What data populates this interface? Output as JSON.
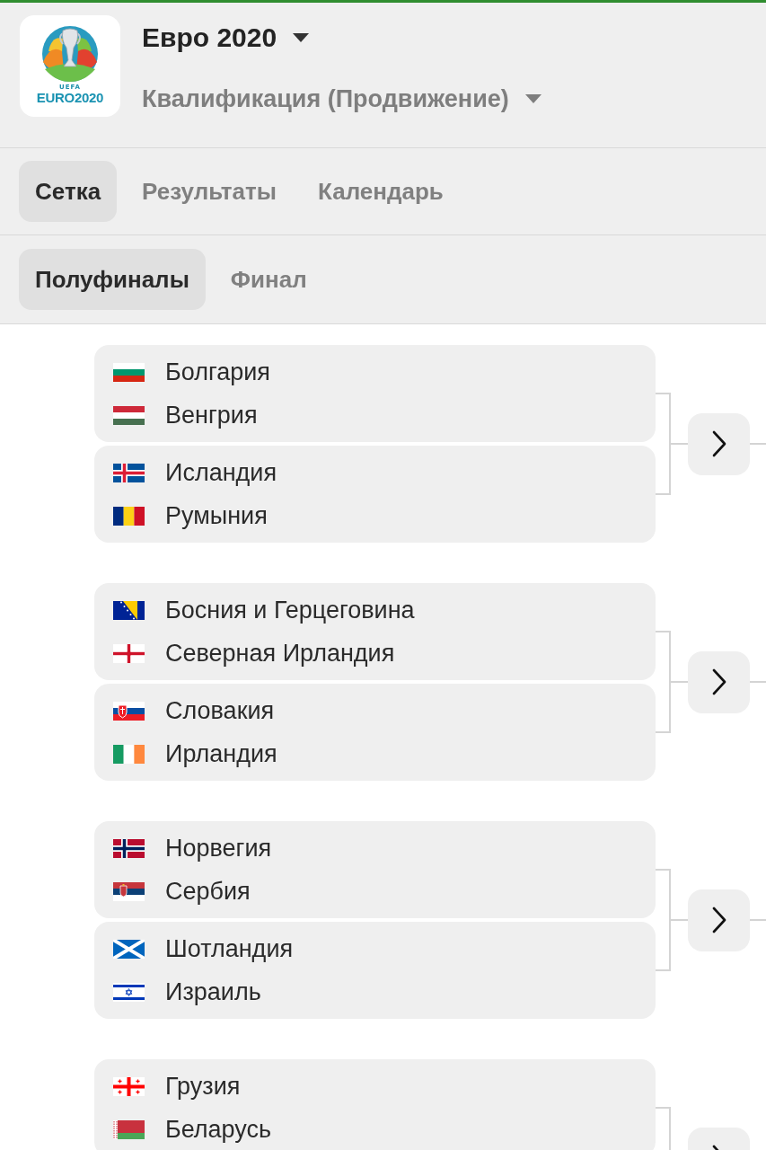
{
  "header": {
    "logo": {
      "mark": "UEFA",
      "wordmark": "EURO2020"
    },
    "tournament": "Евро 2020",
    "stage": "Квалификация (Продвижение)"
  },
  "tabs": [
    {
      "label": "Сетка",
      "selected": true
    },
    {
      "label": "Результаты",
      "selected": false
    },
    {
      "label": "Календарь",
      "selected": false
    }
  ],
  "round_tabs": [
    {
      "label": "Полуфиналы",
      "selected": true
    },
    {
      "label": "Финал",
      "selected": false
    }
  ],
  "bracket": [
    {
      "matches": [
        {
          "teams": [
            {
              "name": "Болгария",
              "kind": "bulgaria"
            },
            {
              "name": "Венгрия",
              "kind": "hungary"
            }
          ]
        },
        {
          "teams": [
            {
              "name": "Исландия",
              "kind": "iceland"
            },
            {
              "name": "Румыния",
              "kind": "romania"
            }
          ]
        }
      ]
    },
    {
      "matches": [
        {
          "teams": [
            {
              "name": "Босния и Герцеговина",
              "kind": "bosnia"
            },
            {
              "name": "Северная Ирландия",
              "kind": "ulster"
            }
          ]
        },
        {
          "teams": [
            {
              "name": "Словакия",
              "kind": "slovakia"
            },
            {
              "name": "Ирландия",
              "kind": "ireland"
            }
          ]
        }
      ]
    },
    {
      "matches": [
        {
          "teams": [
            {
              "name": "Норвегия",
              "kind": "norway"
            },
            {
              "name": "Сербия",
              "kind": "serbia"
            }
          ]
        },
        {
          "teams": [
            {
              "name": "Шотландия",
              "kind": "scotland"
            },
            {
              "name": "Израиль",
              "kind": "israel"
            }
          ]
        }
      ]
    },
    {
      "matches": [
        {
          "teams": [
            {
              "name": "Грузия",
              "kind": "georgia"
            },
            {
              "name": "Беларусь",
              "kind": "belarus"
            }
          ]
        }
      ]
    }
  ]
}
